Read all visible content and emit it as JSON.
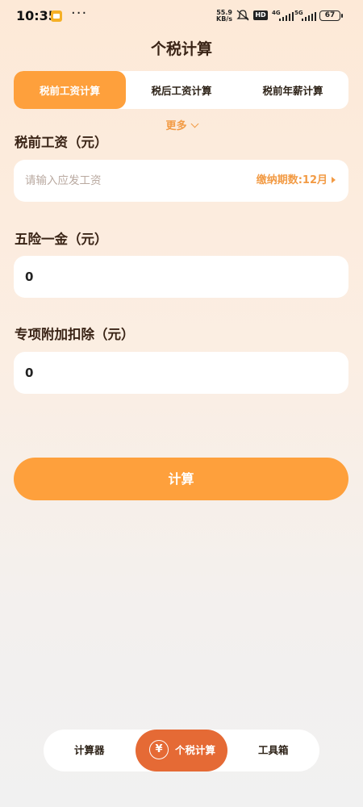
{
  "status_bar": {
    "time": "10:35",
    "more": "···",
    "net_speed_value": "55.9",
    "net_speed_unit": "KB/s",
    "hd": "HD",
    "signal1_label": "4G",
    "signal2_label": "5G",
    "battery": "67"
  },
  "header": {
    "title": "个税计算"
  },
  "tabs": [
    {
      "label": "税前工资计算",
      "active": true
    },
    {
      "label": "税后工资计算",
      "active": false
    },
    {
      "label": "税前年薪计算",
      "active": false
    }
  ],
  "more_toggle": "更多",
  "fields": {
    "salary": {
      "label": "税前工资（元）",
      "placeholder": "请输入应发工资",
      "period": "缴纳期数:12月"
    },
    "insurance": {
      "label": "五险一金（元）",
      "value": "0"
    },
    "deduction": {
      "label": "专项附加扣除（元）",
      "value": "0"
    }
  },
  "calculate_button": "计算",
  "bottom_nav": [
    {
      "label": "计算器",
      "active": false
    },
    {
      "label": "个税计算",
      "active": true,
      "icon": "yuan-icon"
    },
    {
      "label": "工具箱",
      "active": false
    }
  ],
  "colors": {
    "accent": "#fea03c",
    "nav_active": "#e56a35",
    "text_dark": "#3a2416",
    "accent_text": "#f29b45"
  }
}
